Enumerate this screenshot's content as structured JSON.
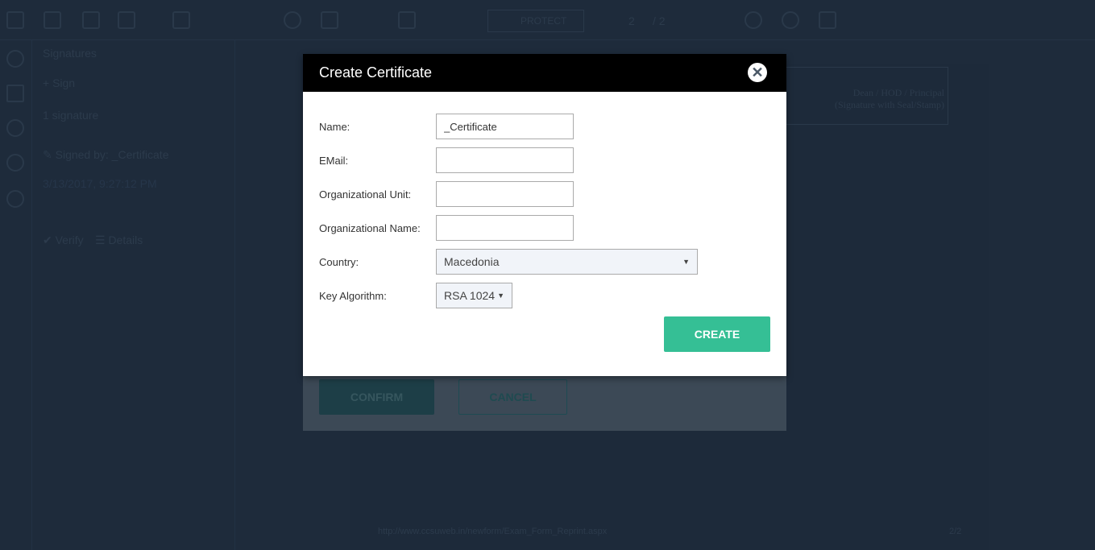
{
  "background": {
    "toolbar": {
      "protect_label": "PROTECT",
      "page_current": "2",
      "page_total": "/ 2"
    },
    "signatures_panel": {
      "title": "Signatures",
      "sign_label": "+ Sign",
      "count_label": "1 signature",
      "signed_by": "✎ Signed by: _Certificate",
      "signed_date": "3/13/2017, 9:27:12 PM",
      "verify_label": "✔ Verify",
      "details_label": "☰ Details"
    },
    "document": {
      "sig_line1": "Dean / HOD / Principal",
      "sig_line2": "(Signature with Seal/Stamp)",
      "footer_url": "http://www.ccsuweb.in/newform/Exam_Form_Reprint.aspx",
      "footer_page": "2/2"
    },
    "confirm_label": "CONFIRM",
    "cancel_label": "CANCEL"
  },
  "modal": {
    "title": "Create Certificate",
    "close_icon": "close-circle-icon",
    "fields": {
      "name": {
        "label": "Name:",
        "value": "_Certificate"
      },
      "email": {
        "label": "EMail:",
        "value": ""
      },
      "org_unit": {
        "label": "Organizational Unit:",
        "value": ""
      },
      "org_name": {
        "label": "Organizational Name:",
        "value": ""
      },
      "country": {
        "label": "Country:",
        "value": "Macedonia"
      },
      "key_algorithm": {
        "label": "Key Algorithm:",
        "value": "RSA 1024"
      }
    },
    "create_label": "CREATE",
    "accent_color": "#35bf95"
  }
}
